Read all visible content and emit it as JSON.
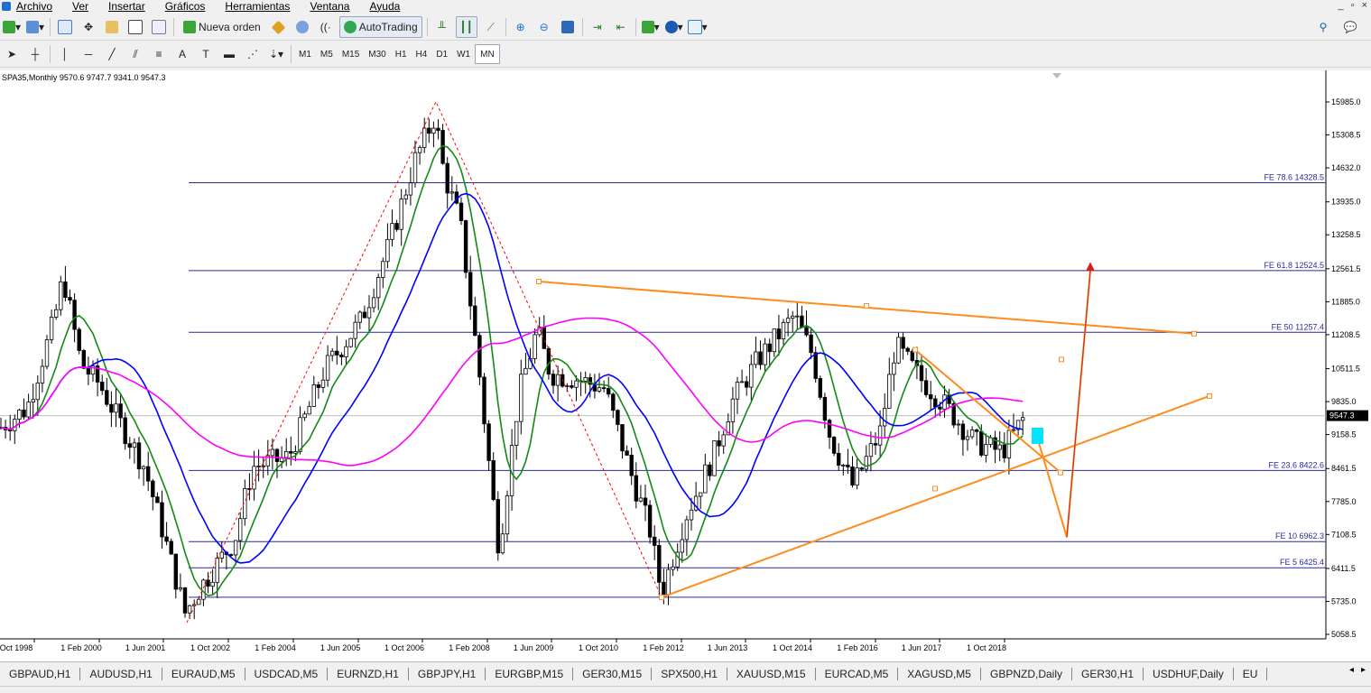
{
  "menu": {
    "items": [
      "Archivo",
      "Ver",
      "Insertar",
      "Gráficos",
      "Herramientas",
      "Ventana",
      "Ayuda"
    ],
    "window_controls": [
      "_",
      "▫",
      "×"
    ]
  },
  "toolbar1": {
    "new_order_label": "Nueva orden",
    "autotrading_label": "AutoTrading"
  },
  "toolbar2": {
    "text_tool": "A",
    "timeframes": [
      "M1",
      "M5",
      "M15",
      "M30",
      "H1",
      "H4",
      "D1",
      "W1",
      "MN"
    ],
    "active_timeframe": "MN"
  },
  "chart": {
    "symbol_info": "SPA35,Monthly  9570.6 9747.7 9341.0 9547.3",
    "price_labels": [
      "15985.0",
      "15308.5",
      "14632.0",
      "13935.0",
      "13258.5",
      "12561.5",
      "11885.0",
      "11208.5",
      "10511.5",
      "9835.0",
      "9158.5",
      "8461.5",
      "7785.0",
      "7108.5",
      "6411.5",
      "5735.0",
      "5058.5"
    ],
    "current_price": "9547.3",
    "date_labels": [
      "Oct 1998",
      "1 Feb 2000",
      "1 Jun 2001",
      "1 Oct 2002",
      "1 Feb 2004",
      "1 Jun 2005",
      "1 Oct 2006",
      "1 Feb 2008",
      "1 Jun 2009",
      "1 Oct 2010",
      "1 Feb 2012",
      "1 Jun 2013",
      "1 Oct 2014",
      "1 Feb 2016",
      "1 Jun 2017",
      "1 Oct 2018"
    ],
    "fib_levels": [
      {
        "label": "FE 78.6 14328.5",
        "price": 14328.5
      },
      {
        "label": "FE 61.8 12524.5",
        "price": 12524.5
      },
      {
        "label": "FE 50 11257.4",
        "price": 11257.4
      },
      {
        "label": "FE 23.6 8422.6",
        "price": 8422.6
      },
      {
        "label": "FE 10 6962.3",
        "price": 6962.3
      },
      {
        "label": "FE 5 6425.4",
        "price": 6425.4
      },
      {
        "label": "",
        "price": 5820
      }
    ],
    "colors": {
      "candle": "#000000",
      "fib": "#2b2b9a",
      "ma_fast": "#138a13",
      "ma_mid": "#0000ff",
      "ma_slow": "#ff00ff",
      "trend": "#ff8c1a",
      "zigzag": "#ff0000",
      "current_line": "#c0c0c0",
      "highlight": "#00e5ff"
    }
  },
  "tabs": [
    "GBPAUD,H1",
    "AUDUSD,H1",
    "EURAUD,M5",
    "USDCAD,M5",
    "EURNZD,H1",
    "GBPJPY,H1",
    "EURGBP,M15",
    "GER30,M15",
    "SPX500,H1",
    "XAUUSD,M15",
    "EURCAD,M5",
    "XAGUSD,M5",
    "GBPNZD,Daily",
    "GER30,H1",
    "USDHUF,Daily",
    "EU"
  ],
  "tab_nav": [
    "◂",
    "▸"
  ]
}
